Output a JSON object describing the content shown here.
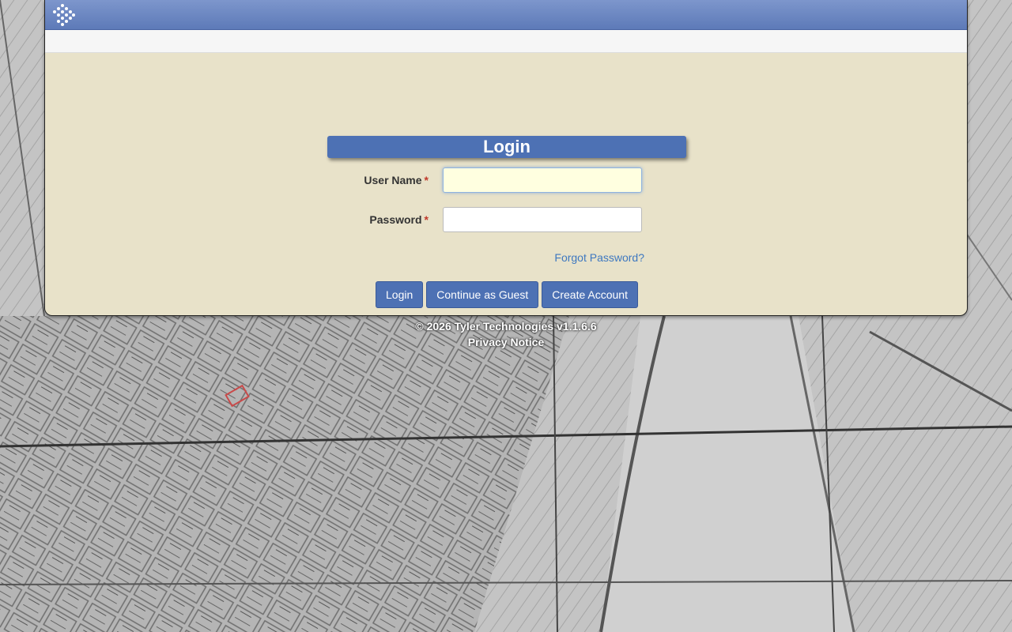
{
  "app": {
    "logo_icon": "tyler-dots-logo-icon"
  },
  "login": {
    "title": "Login",
    "username_label": "User Name",
    "username_value": "",
    "password_label": "Password",
    "password_value": "",
    "required_mark": "*",
    "forgot_password": "Forgot Password?",
    "login_button": "Login",
    "guest_button": "Continue as Guest",
    "create_account_button": "Create Account"
  },
  "footer": {
    "copyright": "© 2026 Tyler Technologies v1.1.6.6",
    "privacy": "Privacy Notice"
  },
  "colors": {
    "header_blue": "#5d7ab8",
    "button_blue": "#4d71b4",
    "panel_beige": "#e8e2c9",
    "link_blue": "#3e78c0",
    "required_red": "#c0392b"
  }
}
